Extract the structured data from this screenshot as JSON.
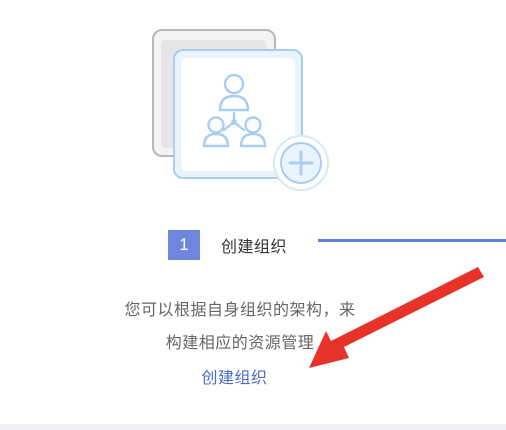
{
  "step": {
    "number": "1",
    "label": "创建组织"
  },
  "description": {
    "line1": "您可以根据自身组织的架构，来",
    "line2": "构建相应的资源管理"
  },
  "action": {
    "create_link": "创建组织"
  },
  "icons": {
    "illustration": "organization-structure-icon",
    "add": "plus-circle-icon",
    "annotation": "red-pointer-arrow"
  },
  "colors": {
    "accent": "#6f86de",
    "link": "#4b6ec3",
    "progress_line": "#5e7ed9",
    "annotation_arrow": "#e8332a",
    "illustration_blue": "#a9cdf0"
  }
}
